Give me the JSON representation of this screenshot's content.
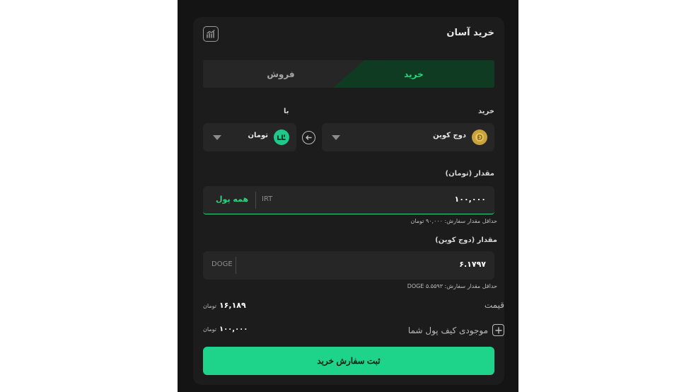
{
  "card": {
    "title": "خرید آسان",
    "chart_icon": "chart-icon"
  },
  "tabs": [
    {
      "label": "خرید",
      "active": true
    },
    {
      "label": "فروش",
      "active": false
    }
  ],
  "pair": {
    "buy_label": "خرید",
    "with_label": "با",
    "buy_coin": {
      "name": "دوج کوین",
      "icon": "doge-icon"
    },
    "pay_coin": {
      "name": "تومان",
      "icon": "toman-icon"
    },
    "swap_icon": "arrow-left-icon"
  },
  "amount_toman": {
    "label": "مقدار (تومان)",
    "value": "۱۰۰,۰۰۰",
    "unit": "IRT",
    "all_button": "همه پول",
    "hint": "حداقل مقدار سفارش: ۹۰,۰۰۰ تومان"
  },
  "amount_coin": {
    "label": "مقدار (دوج کوین)",
    "value": "۶.۱۷۹۷",
    "unit": "DOGE",
    "hint": "حداقل مقدار سفارش: DOGE ۵.۵۵۹۳"
  },
  "price": {
    "label": "قیمت",
    "value": "۱۶,۱۸۹",
    "currency": "تومان"
  },
  "balance": {
    "label": "موجودی کیف پول شما",
    "value": "۱۰۰,۰۰۰",
    "currency": "تومان"
  },
  "submit_label": "ثبت سفارش خرید",
  "colors": {
    "accent": "#1ed48a",
    "tab_active_bg": "#0e3b22",
    "card_bg": "#1c1c1c",
    "field_bg": "#262626"
  }
}
